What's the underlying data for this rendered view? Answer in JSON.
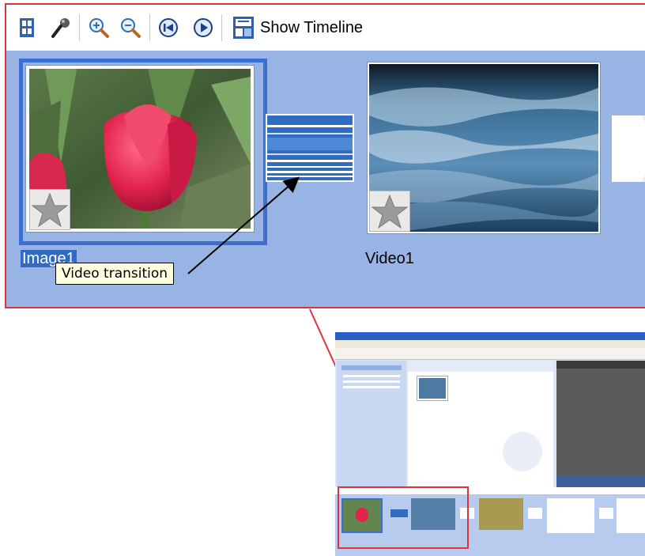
{
  "toolbar": {
    "buttons": [
      {
        "name": "storyboard-icon"
      },
      {
        "name": "narrate-icon"
      },
      {
        "name": "zoom-in-icon"
      },
      {
        "name": "zoom-out-icon"
      },
      {
        "name": "rewind-icon"
      },
      {
        "name": "play-icon"
      }
    ],
    "show_timeline_label": "Show Timeline"
  },
  "storyboard": {
    "clips": [
      {
        "label": "Image1",
        "selected": true
      },
      {
        "label": "Video1",
        "selected": false
      }
    ],
    "tooltip": "Video transition"
  },
  "colors": {
    "highlight_border": "#e0323a",
    "storyboard_bg": "#97b4e4",
    "selection_blue": "#3b6fd1",
    "tooltip_bg": "#ffffe1"
  }
}
